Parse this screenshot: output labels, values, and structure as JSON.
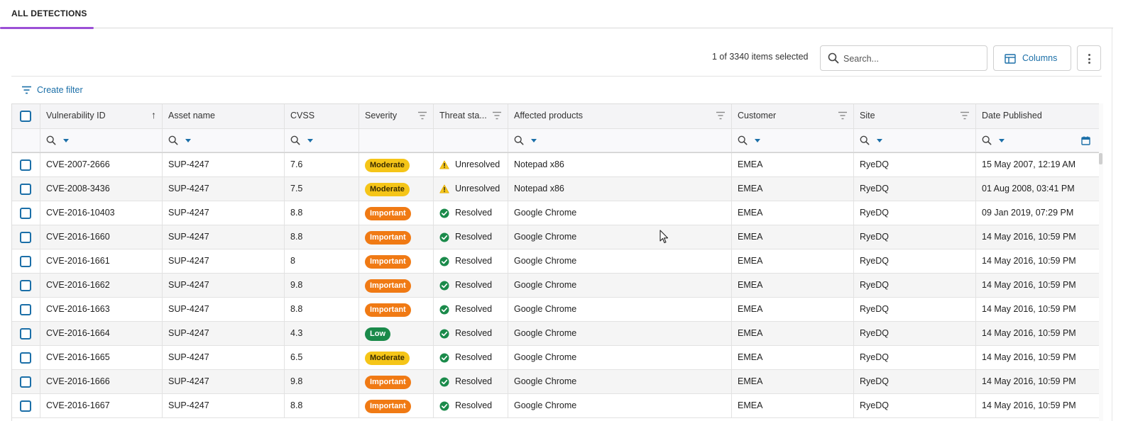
{
  "tabs": [
    {
      "label": "ALL DETECTIONS",
      "active": true
    }
  ],
  "toolbar": {
    "selected_text": "1 of 3340 items selected",
    "search_placeholder": "Search...",
    "columns_label": "Columns",
    "create_filter_label": "Create filter"
  },
  "colors": {
    "accent": "#9b4fd6",
    "link": "#1b6fa8",
    "moderate": "#f5c518",
    "important": "#f07a14",
    "low": "#1a8a4a"
  },
  "columns": [
    {
      "label": "",
      "key": "select"
    },
    {
      "label": "Vulnerability ID",
      "sort": "asc"
    },
    {
      "label": "Asset name"
    },
    {
      "label": "CVSS"
    },
    {
      "label": "Severity",
      "filter_icon": true
    },
    {
      "label": "Threat sta...",
      "filter_icon": true
    },
    {
      "label": "Affected products",
      "filter_icon": true
    },
    {
      "label": "Customer",
      "filter_icon": true
    },
    {
      "label": "Site",
      "filter_icon": true
    },
    {
      "label": "Date Published"
    }
  ],
  "rows": [
    {
      "id": "CVE-2007-2666",
      "asset": "SUP-4247",
      "cvss": "7.6",
      "severity": "Moderate",
      "status": "Unresolved",
      "product": "Notepad x86",
      "customer": "EMEA",
      "site": "RyeDQ",
      "date": "15 May 2007, 12:19 AM"
    },
    {
      "id": "CVE-2008-3436",
      "asset": "SUP-4247",
      "cvss": "7.5",
      "severity": "Moderate",
      "status": "Unresolved",
      "product": "Notepad x86",
      "customer": "EMEA",
      "site": "RyeDQ",
      "date": "01 Aug 2008, 03:41 PM"
    },
    {
      "id": "CVE-2016-10403",
      "asset": "SUP-4247",
      "cvss": "8.8",
      "severity": "Important",
      "status": "Resolved",
      "product": "Google Chrome",
      "customer": "EMEA",
      "site": "RyeDQ",
      "date": "09 Jan 2019, 07:29 PM"
    },
    {
      "id": "CVE-2016-1660",
      "asset": "SUP-4247",
      "cvss": "8.8",
      "severity": "Important",
      "status": "Resolved",
      "product": "Google Chrome",
      "customer": "EMEA",
      "site": "RyeDQ",
      "date": "14 May 2016, 10:59 PM"
    },
    {
      "id": "CVE-2016-1661",
      "asset": "SUP-4247",
      "cvss": "8",
      "severity": "Important",
      "status": "Resolved",
      "product": "Google Chrome",
      "customer": "EMEA",
      "site": "RyeDQ",
      "date": "14 May 2016, 10:59 PM"
    },
    {
      "id": "CVE-2016-1662",
      "asset": "SUP-4247",
      "cvss": "9.8",
      "severity": "Important",
      "status": "Resolved",
      "product": "Google Chrome",
      "customer": "EMEA",
      "site": "RyeDQ",
      "date": "14 May 2016, 10:59 PM"
    },
    {
      "id": "CVE-2016-1663",
      "asset": "SUP-4247",
      "cvss": "8.8",
      "severity": "Important",
      "status": "Resolved",
      "product": "Google Chrome",
      "customer": "EMEA",
      "site": "RyeDQ",
      "date": "14 May 2016, 10:59 PM"
    },
    {
      "id": "CVE-2016-1664",
      "asset": "SUP-4247",
      "cvss": "4.3",
      "severity": "Low",
      "status": "Resolved",
      "product": "Google Chrome",
      "customer": "EMEA",
      "site": "RyeDQ",
      "date": "14 May 2016, 10:59 PM"
    },
    {
      "id": "CVE-2016-1665",
      "asset": "SUP-4247",
      "cvss": "6.5",
      "severity": "Moderate",
      "status": "Resolved",
      "product": "Google Chrome",
      "customer": "EMEA",
      "site": "RyeDQ",
      "date": "14 May 2016, 10:59 PM"
    },
    {
      "id": "CVE-2016-1666",
      "asset": "SUP-4247",
      "cvss": "9.8",
      "severity": "Important",
      "status": "Resolved",
      "product": "Google Chrome",
      "customer": "EMEA",
      "site": "RyeDQ",
      "date": "14 May 2016, 10:59 PM"
    },
    {
      "id": "CVE-2016-1667",
      "asset": "SUP-4247",
      "cvss": "8.8",
      "severity": "Important",
      "status": "Resolved",
      "product": "Google Chrome",
      "customer": "EMEA",
      "site": "RyeDQ",
      "date": "14 May 2016, 10:59 PM"
    }
  ]
}
